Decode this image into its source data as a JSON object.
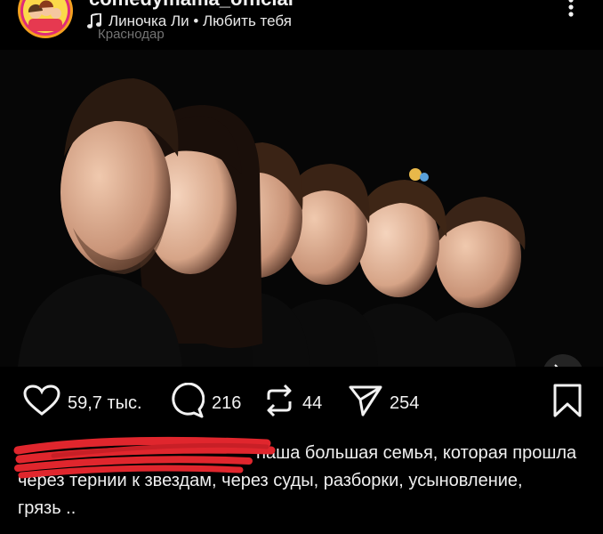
{
  "post": {
    "username": "comedymama_official",
    "music": "Линочка Ли • Любить тебя",
    "location": "Краснодар"
  },
  "actions": {
    "likes": "59,7 тыс.",
    "comments": "216",
    "reposts": "44",
    "shares": "254"
  },
  "caption": {
    "line1": "наша большая семья, которая прошла",
    "line2": "через тернии к звездам, через суды, разборки, усыновление,",
    "line3": "грязь .."
  },
  "icons": {
    "music": "music-note-icon",
    "more": "more-vertical-icon",
    "mute": "mute-speaker-icon",
    "like": "heart-icon",
    "comment": "comment-bubble-icon",
    "repost": "repost-icon",
    "share": "send-paper-plane-icon",
    "save": "bookmark-icon"
  },
  "colors": {
    "background": "#000000",
    "text": "#f2f2f2",
    "secondary": "#9a9a9a",
    "redaction": "#e0262d"
  }
}
